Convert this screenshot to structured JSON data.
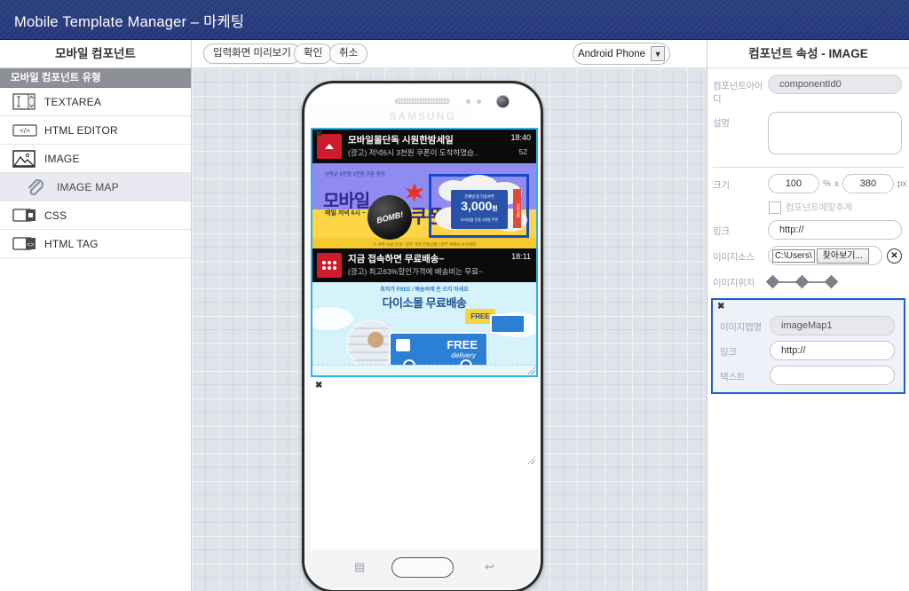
{
  "titlebar": {
    "title": "Mobile Template Manager – 마케팅"
  },
  "sidebar": {
    "title": "모바일 컴포넌트",
    "section_label": "모바일 컴포넌트 유형",
    "items": [
      {
        "label": "TEXTAREA",
        "icon": "textarea-icon"
      },
      {
        "label": "HTML EDITOR",
        "icon": "code-icon"
      },
      {
        "label": "IMAGE",
        "icon": "image-icon"
      },
      {
        "label": "IMAGE MAP",
        "icon": "paperclip-icon"
      },
      {
        "label": "CSS",
        "icon": "css-icon"
      },
      {
        "label": "HTML TAG",
        "icon": "html-tag-icon"
      }
    ]
  },
  "toolbar": {
    "preview_label": "입력화면 미리보기",
    "confirm_label": "확인",
    "cancel_label": "취소",
    "device_value": "Android Phone",
    "device_chevron": "▼"
  },
  "phone": {
    "brand": "SAMSUNG",
    "nav_left": "▤",
    "nav_right": "↩"
  },
  "screen": {
    "close_icon": "✖",
    "notification_1": {
      "title": "모바일몰단독 시원한밤세일",
      "subtitle": "(광고) 저녁6시 3천원 쿠폰이 도착하였습..",
      "time": "18:40",
      "count": "52"
    },
    "banner_top": {
      "small_text": "선착순 6천명 3천원 쿠폰 증정",
      "headline": "모바일",
      "sub_text": "매일 저녁\n6시 ~ 12시",
      "bomb_text": "BOMB!",
      "coupon_word": "쿠폰",
      "footer": "※ 쿠폰 사용 안내 : 일부 가격 한정상품 / 일부 택배사 수신제외"
    },
    "image_map": {
      "coupon_line1": "전채널 중 전용쿠폰",
      "coupon_amount": "3,000",
      "coupon_unit": "원",
      "coupon_line3": "모바일몰 전용 3천원 쿠폰",
      "side_text": "모바일몰"
    },
    "notification_2": {
      "title": "지금 접속하면 무료배송~",
      "subtitle": "(광고) 최고63%할인가격에 배송비는 무료~",
      "time": "18:11"
    },
    "banner_bottom": {
      "top_text": "최저가 FREE / 배송비에 돈 쓰지 마세요",
      "title": "다이소몰 무료배송",
      "truck_main": "FREE",
      "truck_sub": "delivery",
      "tag": "FREE"
    }
  },
  "props": {
    "title": "컴포넌트 속성 - IMAGE",
    "component_id_label": "컴포넌트아이디",
    "component_id_value": "componentId0",
    "description_label": "설명",
    "description_value": "",
    "size_label": "크기",
    "size_width": "100",
    "size_width_unit": "%",
    "size_times": "x",
    "size_height": "380",
    "size_height_unit": "px",
    "fit_checkbox_label": "컴포넌트에맞추게",
    "link_label": "링크",
    "link_value": "http://",
    "image_source_label": "이미지소스",
    "image_source_path": "C:\\Users\\",
    "browse_label": "찾아보기...",
    "clear_icon": "✕",
    "image_position_label": "이미지위치",
    "map_panel": {
      "close_icon": "✖",
      "map_name_label": "이미지맵명",
      "map_name_value": "imageMap1",
      "link_label": "링크",
      "link_value": "http://",
      "text_label": "텍스트",
      "text_value": ""
    }
  }
}
